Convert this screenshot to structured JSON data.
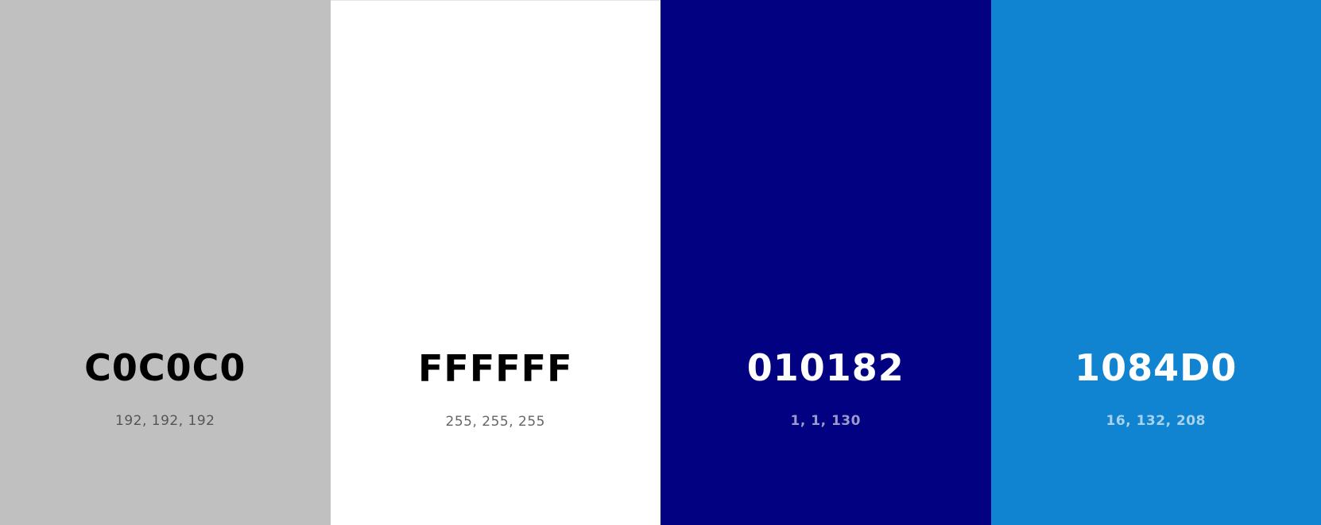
{
  "swatches": [
    {
      "hex": "C0C0C0",
      "rgb": "192, 192, 192",
      "background": "#C0C0C0",
      "hex_color": "#000000",
      "rgb_color": "#555555"
    },
    {
      "hex": "FFFFFF",
      "rgb": "255, 255, 255",
      "background": "#FFFFFF",
      "hex_color": "#000000",
      "rgb_color": "#666666"
    },
    {
      "hex": "010182",
      "rgb": "1, 1, 130",
      "background": "#010182",
      "hex_color": "#FFFFFF",
      "rgb_color": "#9a9acb"
    },
    {
      "hex": "1084D0",
      "rgb": "16, 132, 208",
      "background": "#1084D0",
      "hex_color": "#FFFFFF",
      "rgb_color": "#a9d2ee"
    }
  ]
}
